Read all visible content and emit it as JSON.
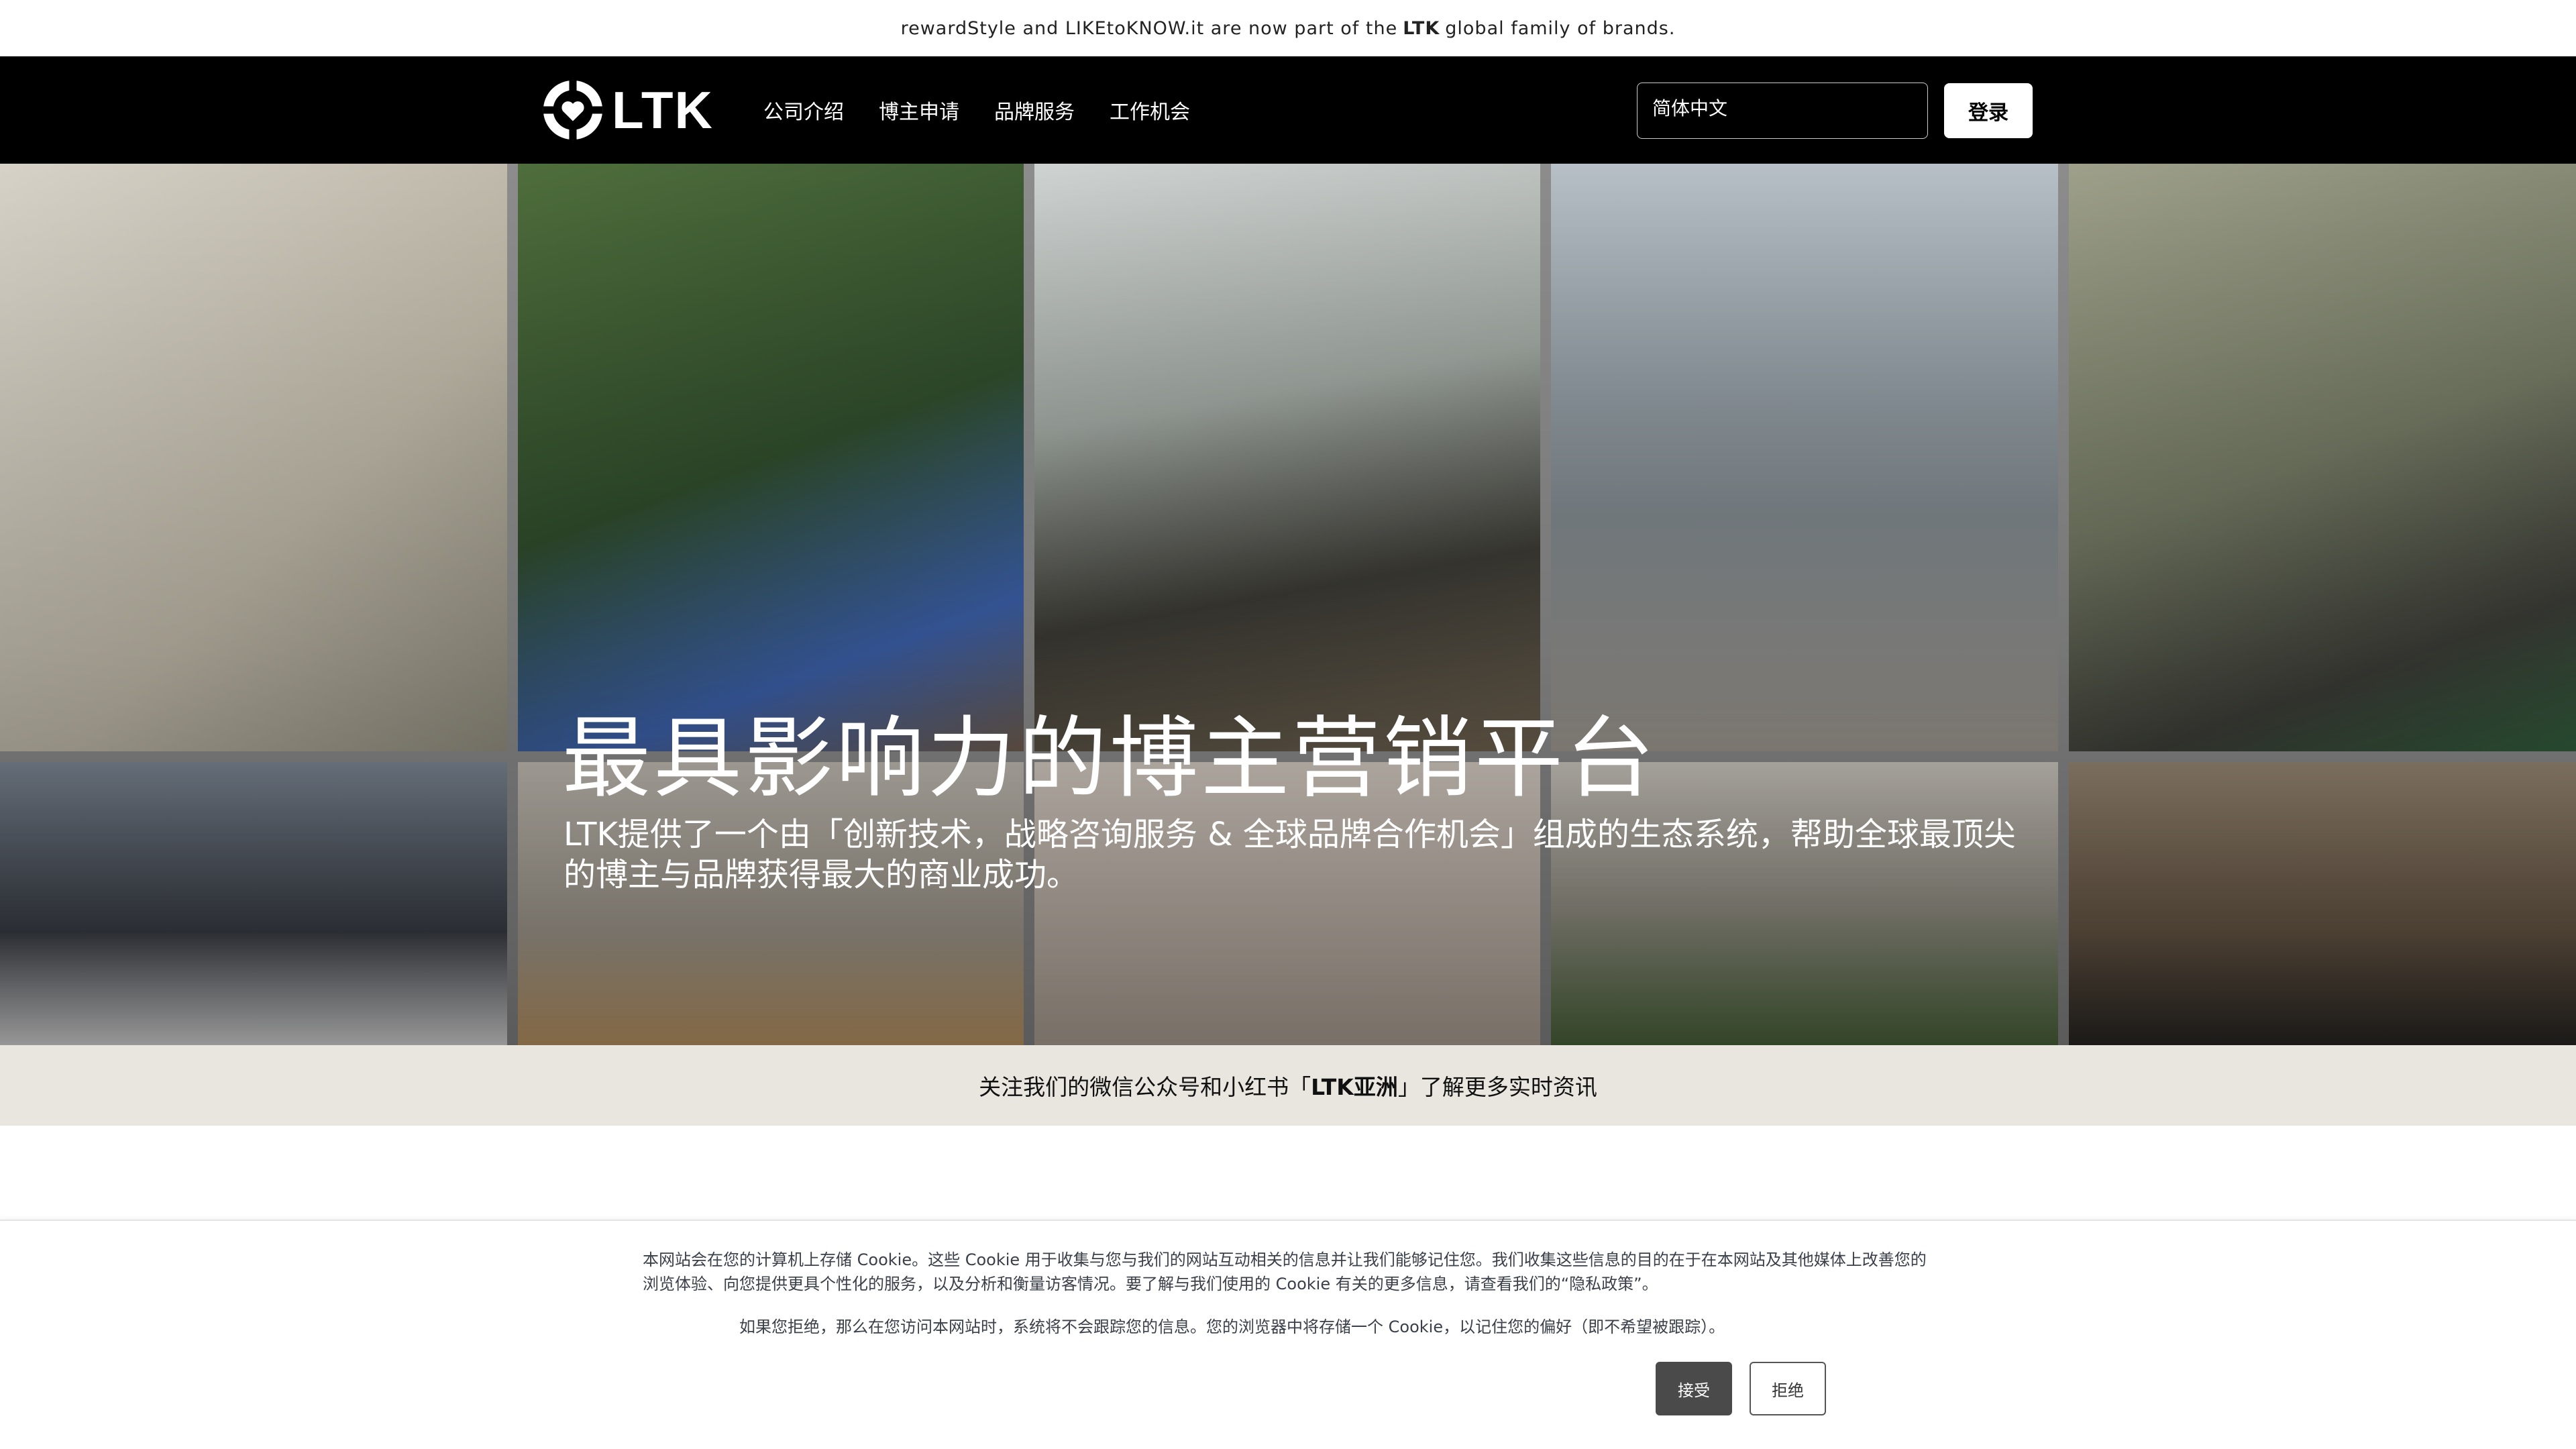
{
  "announcement": {
    "before": "rewardStyle and LIKEtoKNOW.it are now part of the",
    "brand": "LTK",
    "after": "global family of brands."
  },
  "header": {
    "logo_text": "LTK",
    "nav": [
      "公司介绍",
      "博主申请",
      "品牌服务",
      "工作机会"
    ],
    "language_value": "简体中文",
    "login_label": "登录"
  },
  "hero": {
    "title": "最具影响力的博主营销平台",
    "description": "LTK提供了一个由「创新技术，战略咨询服务 & 全球品牌合作机会」组成的生态系统，帮助全球最顶尖的博主与品牌获得最大的商业成功。"
  },
  "follow": {
    "before": "关注我们的微信公众号和小红书「",
    "brand": "LTK亚洲",
    "after": "」了解更多实时资讯"
  },
  "cookie": {
    "text1": "本网站会在您的计算机上存储 Cookie。这些 Cookie 用于收集与您与我们的网站互动相关的信息并让我们能够记住您。我们收集这些信息的目的在于在本网站及其他媒体上改善您的浏览体验、向您提供更具个性化的服务，以及分析和衡量访客情况。要了解与我们使用的 Cookie 有关的更多信息，请查看我们的“隐私政策”。",
    "text2": "如果您拒绝，那么在您访问本网站时，系统将不会跟踪您的信息。您的浏览器中将存储一个 Cookie，以记住您的偏好（即不希望被跟踪）。",
    "accept_label": "接受",
    "decline_label": "拒绝"
  },
  "colors": {
    "header_bg": "#000000",
    "follow_bg": "#e9e6df",
    "accept_bg": "#4a4a4a"
  }
}
